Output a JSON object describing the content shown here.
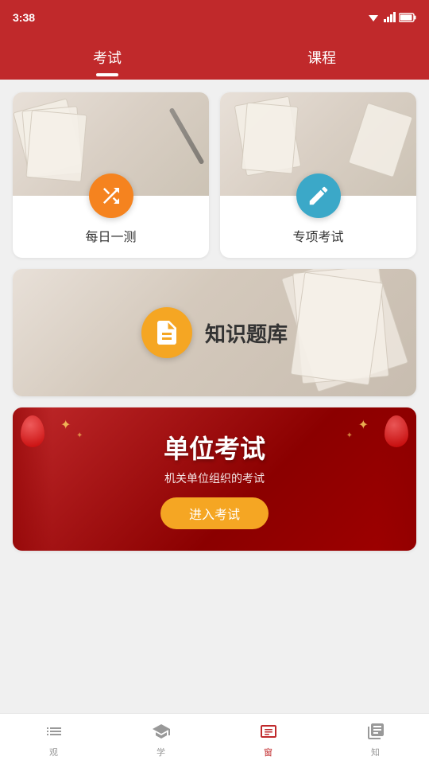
{
  "statusBar": {
    "time": "3:38",
    "icons": [
      "battery",
      "wifi",
      "signal"
    ]
  },
  "header": {
    "tabs": [
      {
        "id": "exam",
        "label": "考试",
        "active": true
      },
      {
        "id": "course",
        "label": "课程",
        "active": false
      }
    ]
  },
  "main": {
    "card_daily": {
      "title": "每日一测",
      "icon_color": "#f5831f",
      "icon_type": "shuffle"
    },
    "card_special": {
      "title": "专项考试",
      "icon_color": "#3ba8c8",
      "icon_type": "edit"
    },
    "card_knowledge": {
      "title": "知识题库",
      "icon_color": "#f5a623",
      "icon_type": "document"
    },
    "card_unit": {
      "title": "单位考试",
      "subtitle": "机关单位组织的考试",
      "btn_label": "进入考试"
    }
  },
  "bottomNav": {
    "items": [
      {
        "id": "overview",
        "label": "观",
        "active": false
      },
      {
        "id": "learn",
        "label": "学",
        "active": false
      },
      {
        "id": "exam",
        "label": "窗",
        "active": true
      },
      {
        "id": "knowledge",
        "label": "知",
        "active": false
      }
    ]
  }
}
